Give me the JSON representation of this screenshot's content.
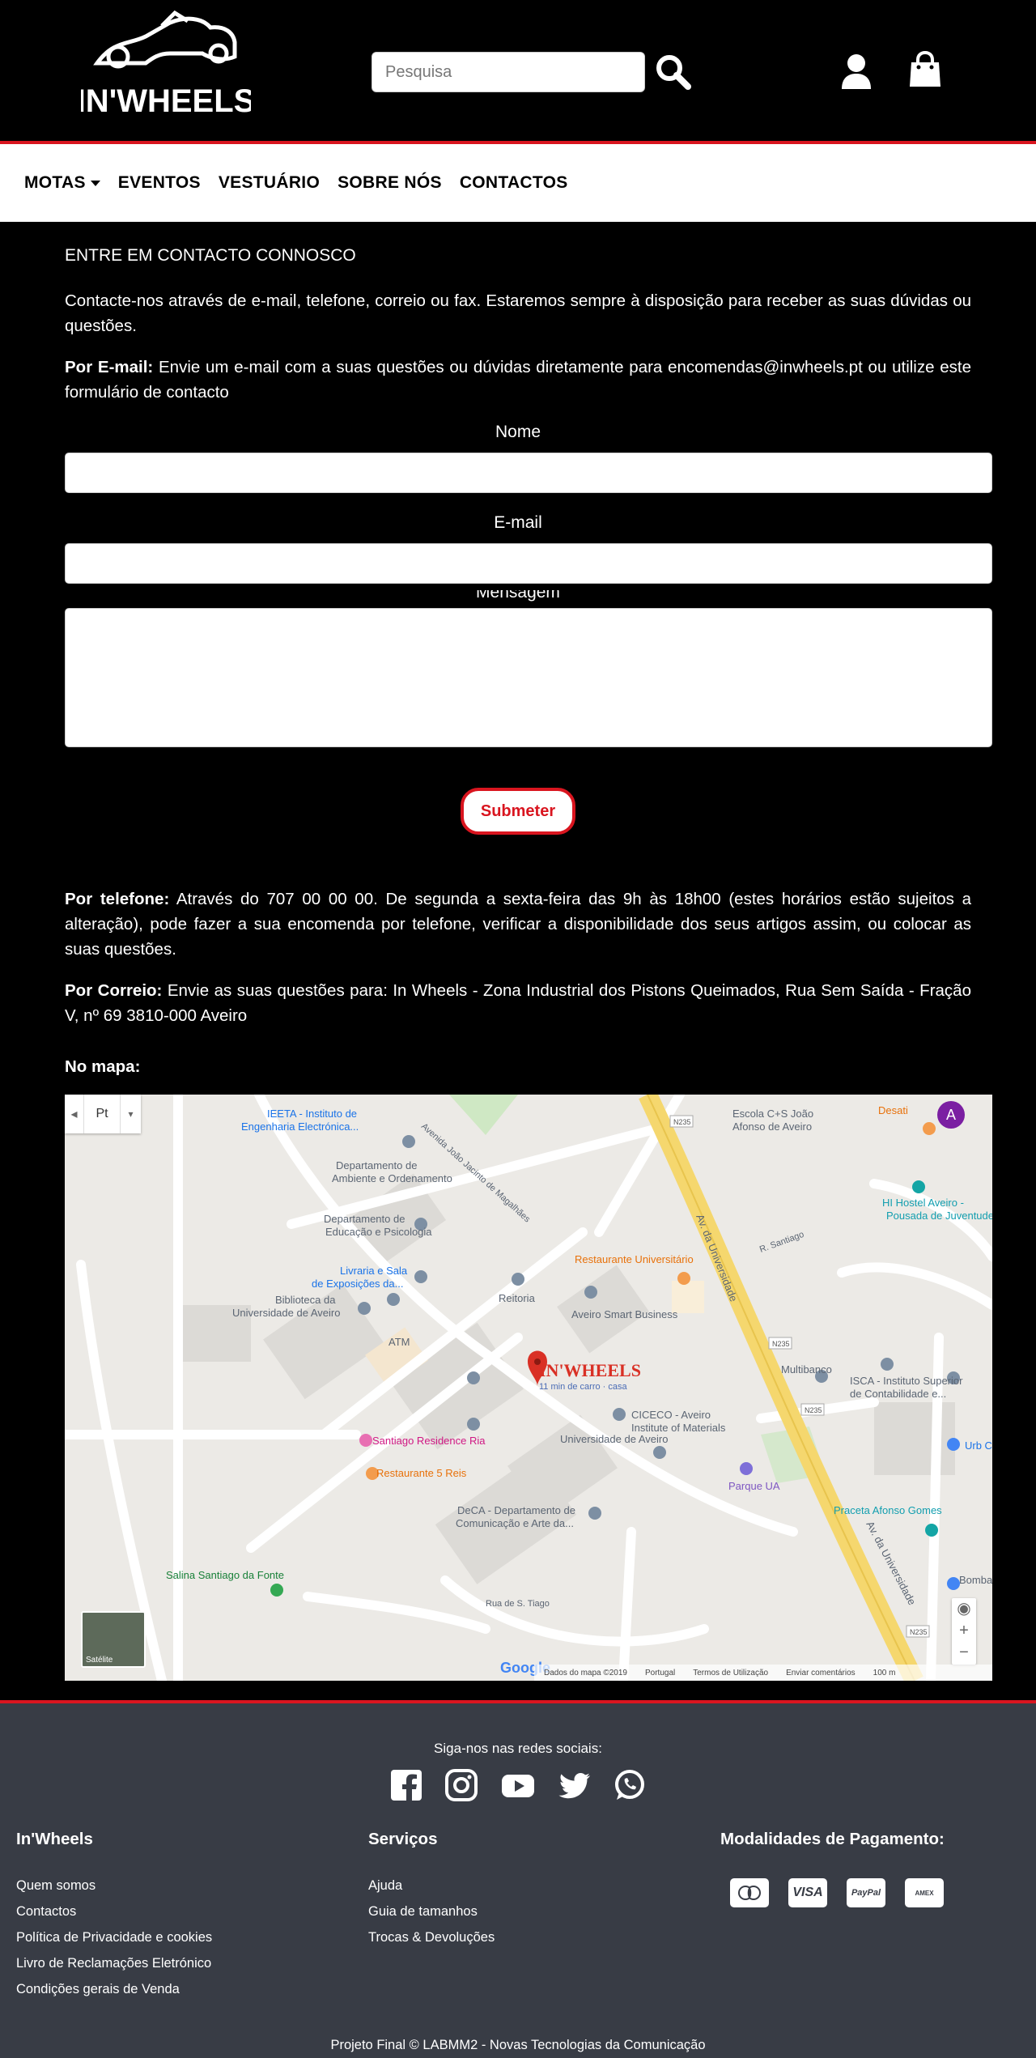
{
  "brand": {
    "logo_text": "IN'WHEELS"
  },
  "search": {
    "placeholder": "Pesquisa"
  },
  "nav": {
    "items": [
      "MOTAS",
      "EVENTOS",
      "VESTUÁRIO",
      "SOBRE NÓS",
      "CONTACTOS"
    ]
  },
  "contact": {
    "heading": "ENTRE EM CONTACTO CONNOSCO",
    "intro": "Contacte-nos através de e-mail, telefone, correio ou fax. Estaremos sempre à disposição para receber as suas dúvidas ou questões.",
    "email_label": "Por E-mail:",
    "email_text": " Envie um e-mail com a suas questões ou dúvidas diretamente para encomendas@inwheels.pt ou utilize este formulário de contacto",
    "form": {
      "name_label": "Nome",
      "email_label": "E-mail",
      "message_label": "Mensagem",
      "submit_label": "Submeter"
    },
    "phone_label": "Por telefone:",
    "phone_text": " Através do 707 00 00 00. De segunda a sexta-feira das 9h às 18h00 (estes horários estão sujeitos a alteração), pode fazer a sua encomenda por telefone, verificar a disponibilidade dos seus artigos assim, ou colocar as suas questões.",
    "mail_label": "Por Correio:",
    "mail_text": " Envie as suas questões para: In Wheels - Zona Industrial dos Pistons Queimados, Rua Sem Saída - Fração V, nº 69 3810-000 Aveiro",
    "map_label": "No mapa:"
  },
  "map": {
    "lang": "Pt",
    "avatar_letter": "A",
    "satellite_label": "Satélite",
    "marker_label": "IN'WHEELS",
    "marker_sub": "11 min de carro · casa",
    "places": [
      "IEETA - Instituto de",
      "Engenharia Electrónica...",
      "Departamento de",
      "Ambiente e Ordenamento",
      "Departamento de",
      "Educação e Psicologia",
      "Livraria e Sala",
      "de Exposições da...",
      "Biblioteca da",
      "Universidade de Aveiro",
      "ATM",
      "Reitoria",
      "Aveiro Smart Business",
      "Restaurante Universitário",
      "Escola C+S João",
      "Afonso de Aveiro",
      "HI Hostel Aveiro -",
      "Pousada de Juventude",
      "Multibanco",
      "ISCA - Instituto Superior",
      "de Contabilidade e...",
      "CICECO - Aveiro",
      "Institute of Materials",
      "Universidade de Aveiro",
      "Santiago Residence Ria",
      "Restaurante 5 Reis",
      "Parque UA",
      "Praceta Afonso Gomes",
      "DeCA - Departamento de",
      "Comunicação e Arte da...",
      "Salina Santiago da Fonte",
      "Rua de S. Tiago",
      "Av. da Universidade",
      "Av. da Universidade",
      "R. Santiago",
      "Avenida João Jacinto de Magalhães",
      "Desati",
      "Urb C",
      "Bombas",
      "N235",
      "N235",
      "N235",
      "N235"
    ],
    "footer": [
      "Dados do mapa ©2019",
      "Portugal",
      "Termos de Utilização",
      "Enviar comentários",
      "100 m"
    ]
  },
  "footer": {
    "follow_text": "Siga-nos nas redes sociais:",
    "col1": {
      "title": "In'Wheels",
      "links": [
        "Quem somos",
        "Contactos",
        "Política de Privacidade e cookies",
        "Livro de Reclamações Eletrónico",
        "Condições gerais de Venda"
      ]
    },
    "col2": {
      "title": "Serviços",
      "links": [
        "Ajuda",
        "Guia de tamanhos",
        "Trocas & Devoluções"
      ]
    },
    "col3": {
      "title": "Modalidades de Pagamento:",
      "methods": [
        "Mastercard",
        "VISA",
        "PayPal",
        "AMEX"
      ]
    },
    "copyright": "Projeto Final © LABMM2 - Novas Tecnologias da Comunicação"
  },
  "colors": {
    "accent": "#d9151f",
    "footer_bg": "#383c45",
    "map_road": "#f5d76e"
  }
}
